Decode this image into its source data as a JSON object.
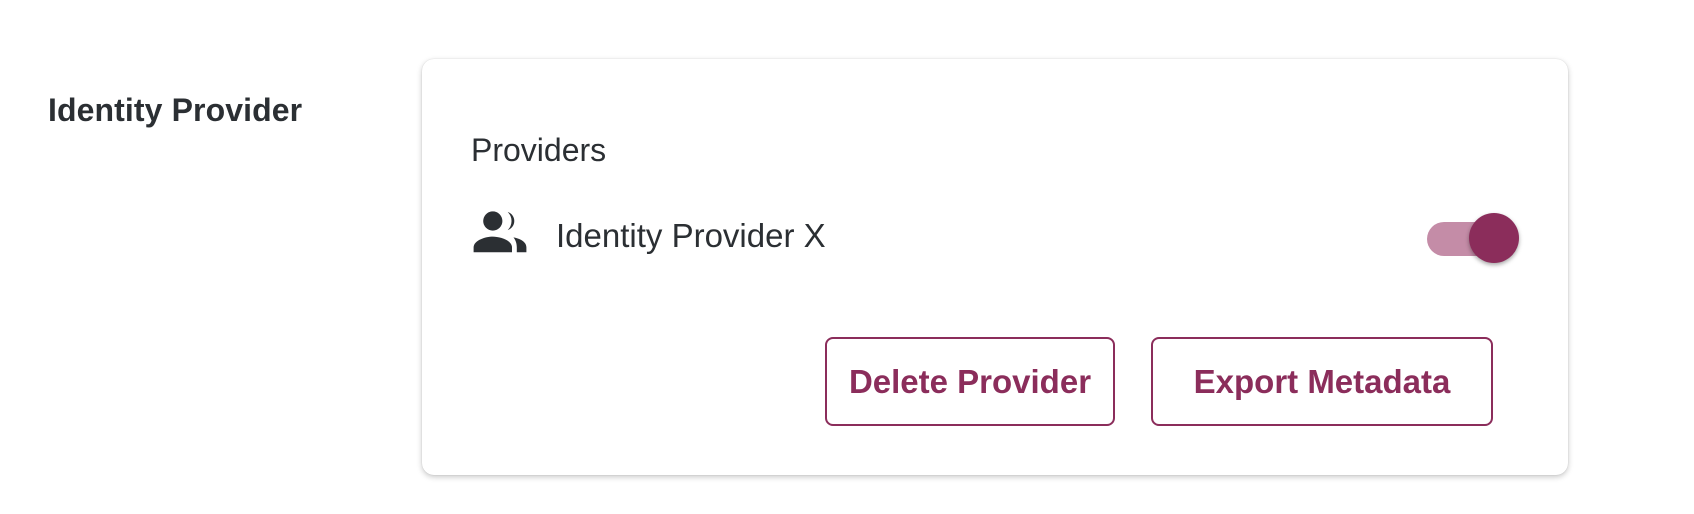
{
  "section": {
    "label": "Identity Provider"
  },
  "card": {
    "heading": "Providers",
    "provider": {
      "icon": "people-icon",
      "name": "Identity Provider X",
      "enabled": true
    },
    "actions": {
      "delete_label": "Delete Provider",
      "export_label": "Export Metadata"
    }
  },
  "colors": {
    "accent": "#8b2d5b",
    "toggle_track": "#c48ca7",
    "text": "#2b2f33"
  }
}
